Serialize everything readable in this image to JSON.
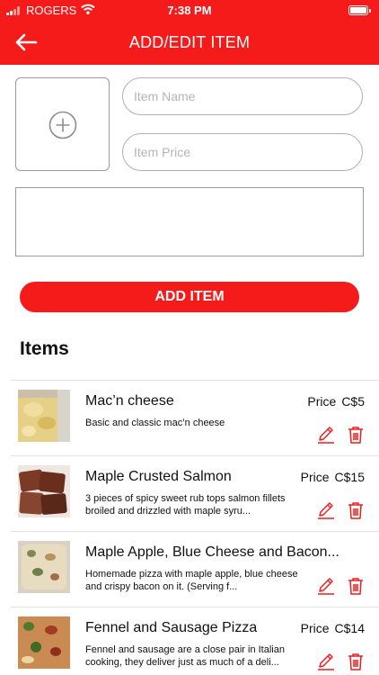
{
  "status_bar": {
    "carrier": "ROGERS",
    "time": "7:38 PM"
  },
  "header": {
    "title": "ADD/EDIT ITEM",
    "back_icon": "back-arrow-icon"
  },
  "form": {
    "photo_icon": "plus-circle-icon",
    "name_placeholder": "Item Name",
    "price_placeholder": "Item Price",
    "description_value": "",
    "submit_label": "ADD ITEM"
  },
  "items_heading": "Items",
  "price_label": "Price",
  "items": [
    {
      "name": "Mac’n cheese",
      "price": "C$5",
      "description": "Basic and classic mac’n cheese",
      "image": "mac-n-cheese-photo"
    },
    {
      "name": "Maple Crusted Salmon",
      "price": "C$15",
      "description": "3 pieces of spicy sweet rub tops salmon fillets broiled and drizzled with maple syru...",
      "image": "salmon-photo"
    },
    {
      "name": "Maple Apple, Blue Cheese and Bacon...",
      "price": "",
      "description": "Homemade pizza with maple apple, blue cheese and crispy bacon on it.  (Serving f...",
      "image": "apple-pizza-photo"
    },
    {
      "name": "Fennel and Sausage Pizza",
      "price": "C$14",
      "description": "Fennel and sausage are a close pair in Italian cooking, they deliver just as much of a deli...",
      "image": "fennel-pizza-photo"
    }
  ],
  "colors": {
    "accent": "#f51b1b",
    "text": "#111111",
    "placeholder": "#b5b5b5"
  }
}
